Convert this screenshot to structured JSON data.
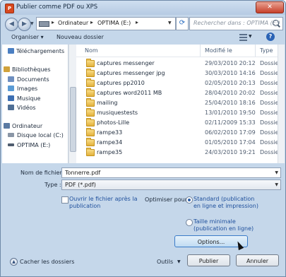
{
  "window": {
    "title": "Publier comme PDF ou XPS",
    "close_label": "✕",
    "app_icon_letter": "P"
  },
  "address_bar": {
    "breadcrumbs": [
      "Ordinateur",
      "OPTIMA (E:)"
    ],
    "search_placeholder": "Rechercher dans : OPTIMA (E:)"
  },
  "toolbar": {
    "organize_label": "Organiser ▾",
    "new_folder_label": "Nouveau dossier"
  },
  "sidebar": {
    "items": [
      {
        "label": "Téléchargements",
        "icon": "download-folder-icon",
        "color": "#4b7fc2"
      },
      {
        "label": "Bibliothèques",
        "icon": "libraries-icon",
        "color": "#d0a23c"
      },
      {
        "label": "Documents",
        "icon": "documents-icon",
        "color": "#6e8fc0"
      },
      {
        "label": "Images",
        "icon": "images-icon",
        "color": "#5a9bd5"
      },
      {
        "label": "Musique",
        "icon": "music-icon",
        "color": "#3c6fb3"
      },
      {
        "label": "Vidéos",
        "icon": "videos-icon",
        "color": "#4f6f95"
      },
      {
        "label": "Ordinateur",
        "icon": "computer-icon",
        "color": "#5b7aa3"
      },
      {
        "label": "Disque local (C:)",
        "icon": "drive-icon",
        "color": "#8a96a6"
      },
      {
        "label": "OPTIMA (E:)",
        "icon": "usb-drive-icon",
        "color": "#4e5c6e"
      }
    ]
  },
  "file_list": {
    "columns": [
      "Nom",
      "Modifié le",
      "Type"
    ],
    "rows": [
      {
        "name": "captures messenger",
        "date": "29/03/2010 20:12",
        "type": "Dossie"
      },
      {
        "name": "captures messenger jpg",
        "date": "30/03/2010 14:16",
        "type": "Dossie"
      },
      {
        "name": "captures pp2010",
        "date": "02/05/2010 20:13",
        "type": "Dossie"
      },
      {
        "name": "captures word2011 MB",
        "date": "28/04/2010 20:02",
        "type": "Dossie"
      },
      {
        "name": "mailing",
        "date": "25/04/2010 18:16",
        "type": "Dossie"
      },
      {
        "name": "musiquestests",
        "date": "13/01/2010 19:50",
        "type": "Dossie"
      },
      {
        "name": "photos-Lille",
        "date": "02/11/2009 15:33",
        "type": "Dossie"
      },
      {
        "name": "rampe33",
        "date": "06/02/2010 17:09",
        "type": "Dossie"
      },
      {
        "name": "rampe34",
        "date": "01/05/2010 17:04",
        "type": "Dossie"
      },
      {
        "name": "rampe35",
        "date": "24/03/2010 19:21",
        "type": "Dossie"
      }
    ]
  },
  "form": {
    "filename_label": "Nom de fichier :",
    "filename_value": "Tonnerre.pdf",
    "type_label": "Type :",
    "type_value": "PDF (*.pdf)",
    "open_after_label": "Ouvrir le fichier après la publication",
    "optimize_label": "Optimiser pour :",
    "standard_label": "Standard (publication en ligne et impression)",
    "minimal_label": "Taille minimale (publication en ligne)",
    "options_label": "Options..."
  },
  "footer": {
    "hide_folders_label": "Cacher les dossiers",
    "tools_label": "Outils",
    "publish_label": "Publier",
    "cancel_label": "Annuler"
  }
}
